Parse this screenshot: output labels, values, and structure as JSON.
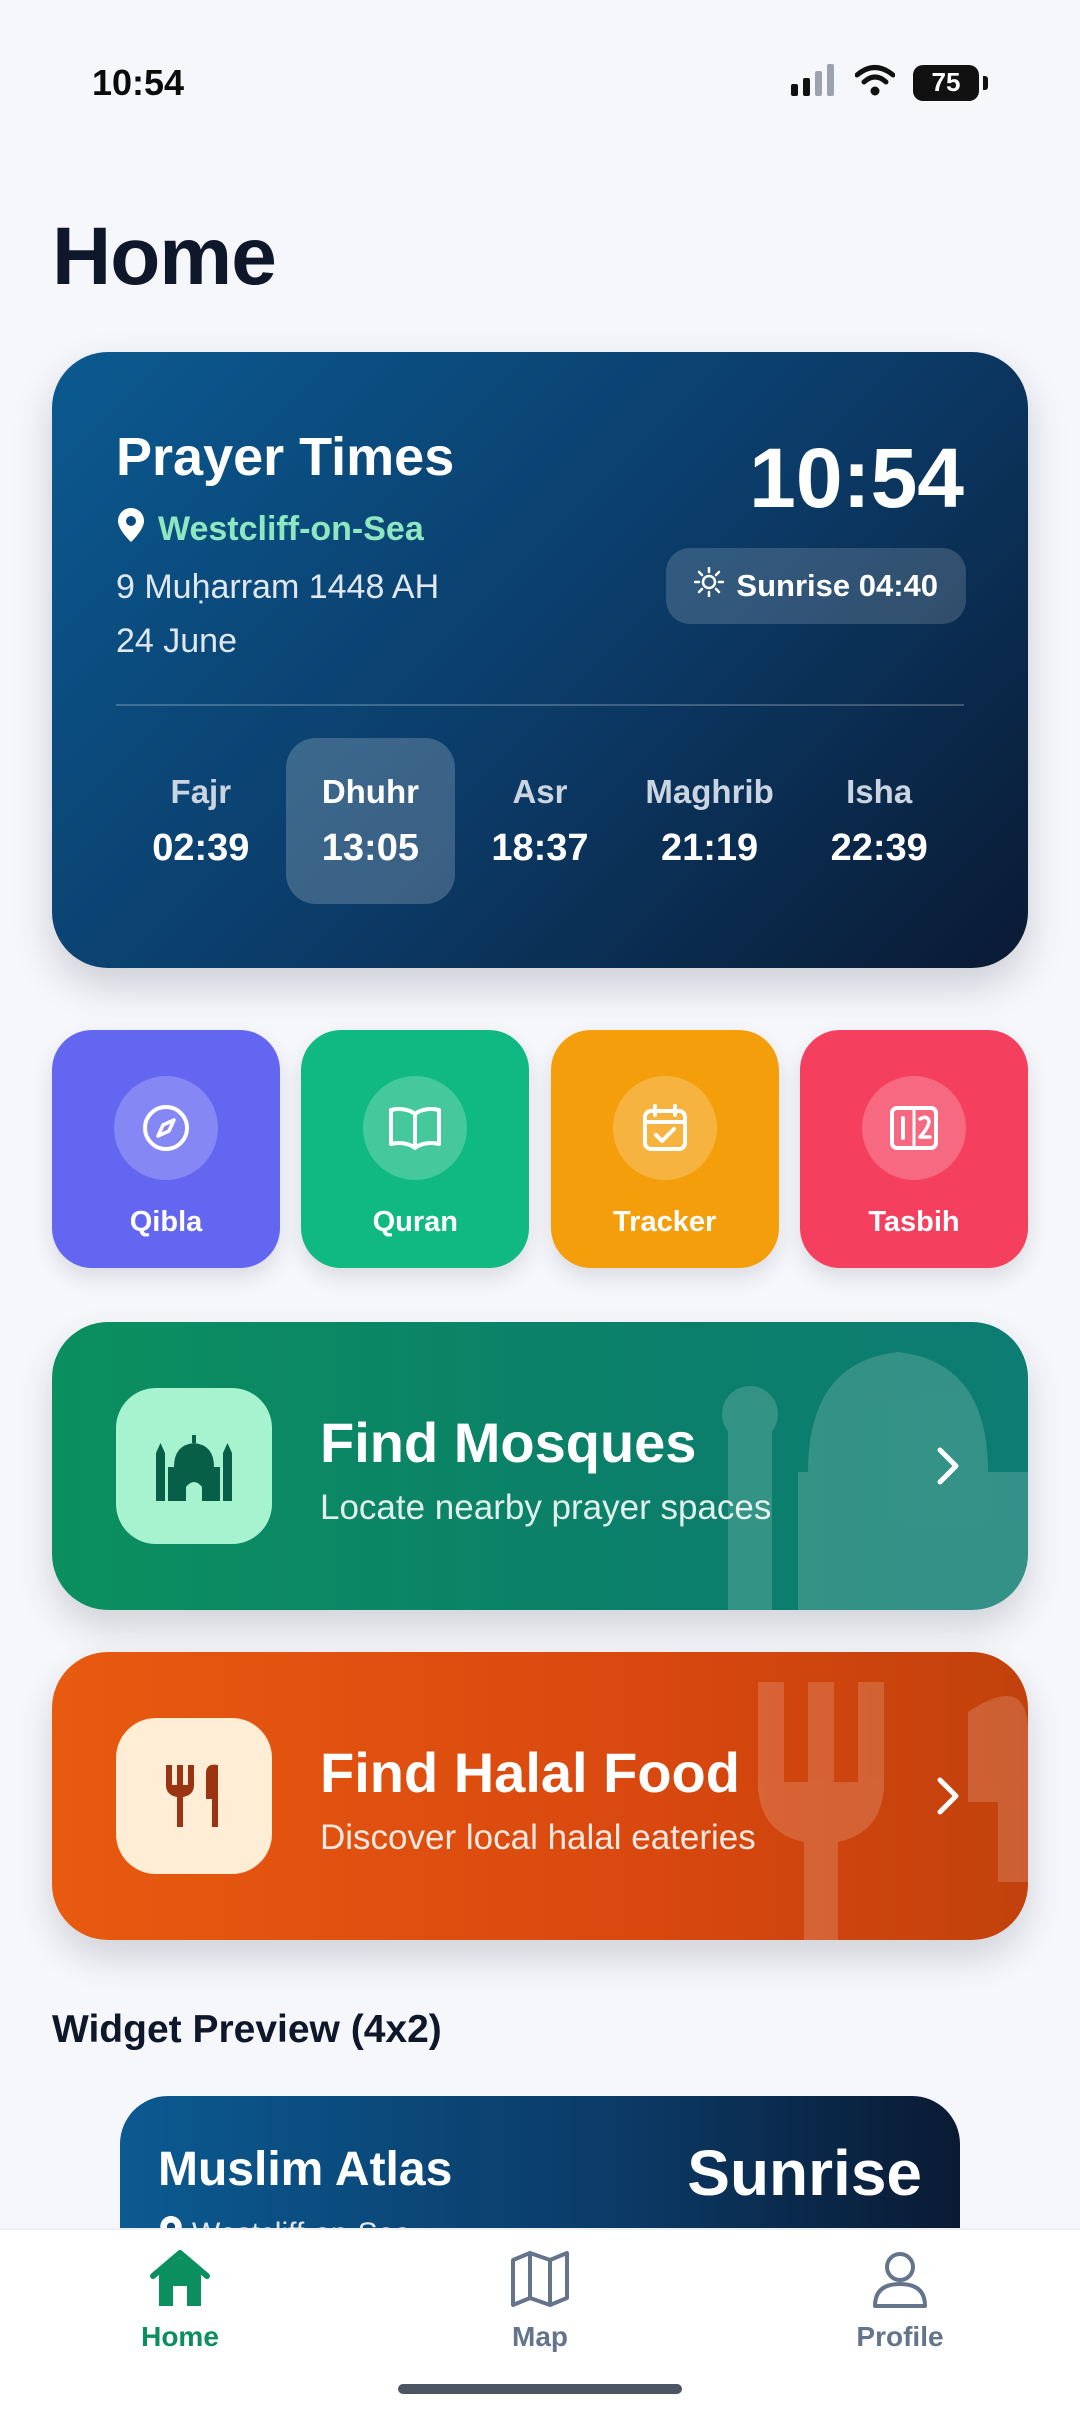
{
  "status_bar": {
    "time": "10:54",
    "battery": "75"
  },
  "page": {
    "title": "Home"
  },
  "prayer_card": {
    "title": "Prayer Times",
    "location": "Westcliff-on-Sea",
    "hijri_date": "9 Muḥarram 1448 AH",
    "date": "24 June",
    "clock": "10:54",
    "sunrise": "Sunrise 04:40",
    "prayers": [
      {
        "name": "Fajr",
        "time": "02:39"
      },
      {
        "name": "Dhuhr",
        "time": "13:05"
      },
      {
        "name": "Asr",
        "time": "18:37"
      },
      {
        "name": "Maghrib",
        "time": "21:19"
      },
      {
        "name": "Isha",
        "time": "22:39"
      }
    ],
    "active_prayer": "Dhuhr"
  },
  "tiles": [
    {
      "label": "Qibla",
      "color": "#6366f1",
      "icon": "compass-icon"
    },
    {
      "label": "Quran",
      "color": "#10b981",
      "icon": "book-open-icon"
    },
    {
      "label": "Tracker",
      "color": "#f59e0b",
      "icon": "calendar-check-icon"
    },
    {
      "label": "Tasbih",
      "color": "#f43f5e",
      "icon": "counter-icon"
    }
  ],
  "features": {
    "mosques": {
      "title": "Find Mosques",
      "subtitle": "Locate nearby prayer spaces",
      "icon": "mosque-icon"
    },
    "food": {
      "title": "Find Halal Food",
      "subtitle": "Discover local halal eateries",
      "icon": "utensils-icon"
    }
  },
  "widget_section": {
    "title": "Widget Preview (4x2)"
  },
  "widget": {
    "app_name": "Muslim Atlas",
    "next_event": "Sunrise",
    "location": "Westcliff-on-Sea"
  },
  "nav": [
    {
      "label": "Home",
      "icon": "home-icon"
    },
    {
      "label": "Map",
      "icon": "map-icon"
    },
    {
      "label": "Profile",
      "icon": "profile-icon"
    }
  ],
  "colors": {
    "accent": "#0b8f5f",
    "prayer_card": "#0b3a66",
    "food": "#e85a10"
  }
}
